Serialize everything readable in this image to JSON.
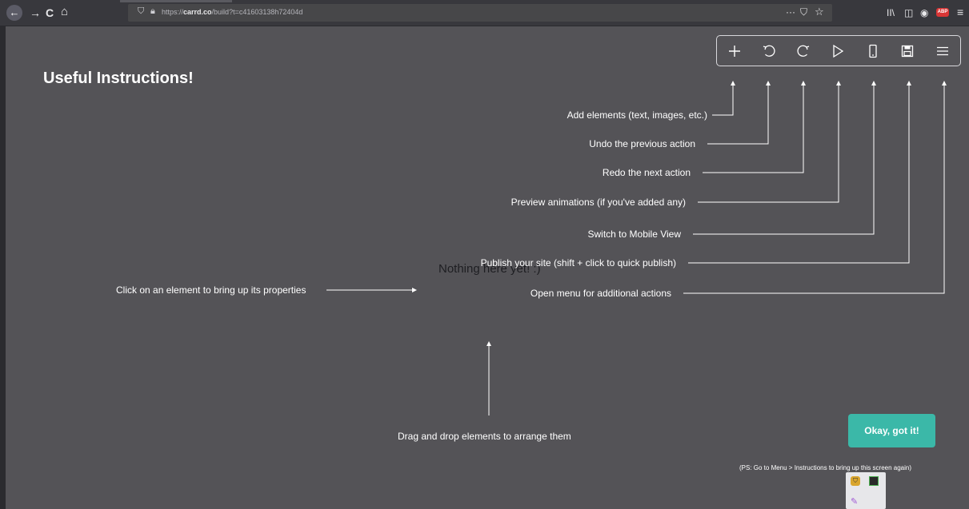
{
  "browser": {
    "url_prefix": "https://",
    "url_domain": "carrd.co",
    "url_path": "/build?t=c41603138h72404d",
    "back_icon": "←",
    "forward_icon": "→",
    "reload_icon": "C",
    "home_icon": "⌂",
    "page_actions_icon": "···",
    "pocket_icon": "⛉",
    "bookmark_icon": "☆",
    "library_icon": "II\\",
    "sidebar_icon": "◫",
    "account_icon": "◉",
    "adblock_label": "ABP",
    "menu_icon": "≡"
  },
  "page": {
    "heading": "Useful Instructions!",
    "placeholder": "Nothing here yet! :)",
    "ok_button": "Okay, got it!",
    "ps_note": "(PS: Go to Menu > Instructions to bring up this screen again)"
  },
  "toolbar": {
    "items": [
      {
        "name": "add",
        "icon": "plus-icon"
      },
      {
        "name": "undo",
        "icon": "undo-icon"
      },
      {
        "name": "redo",
        "icon": "redo-icon"
      },
      {
        "name": "preview",
        "icon": "play-icon"
      },
      {
        "name": "mobile",
        "icon": "phone-icon"
      },
      {
        "name": "publish",
        "icon": "save-icon"
      },
      {
        "name": "menu",
        "icon": "menu-icon"
      }
    ]
  },
  "instructions": {
    "add": "Add elements (text, images, etc.)",
    "undo": "Undo the previous action",
    "redo": "Redo the next action",
    "preview": "Preview animations (if you've added any)",
    "mobile": "Switch to Mobile View",
    "publish": "Publish your site (shift + click to quick publish)",
    "menu": "Open menu for additional actions",
    "properties": "Click on an element to bring up its properties",
    "drag": "Drag and drop elements to arrange them"
  },
  "colors": {
    "background": "#545357",
    "accent": "#3bb8a8",
    "browser_chrome": "#38383d"
  }
}
